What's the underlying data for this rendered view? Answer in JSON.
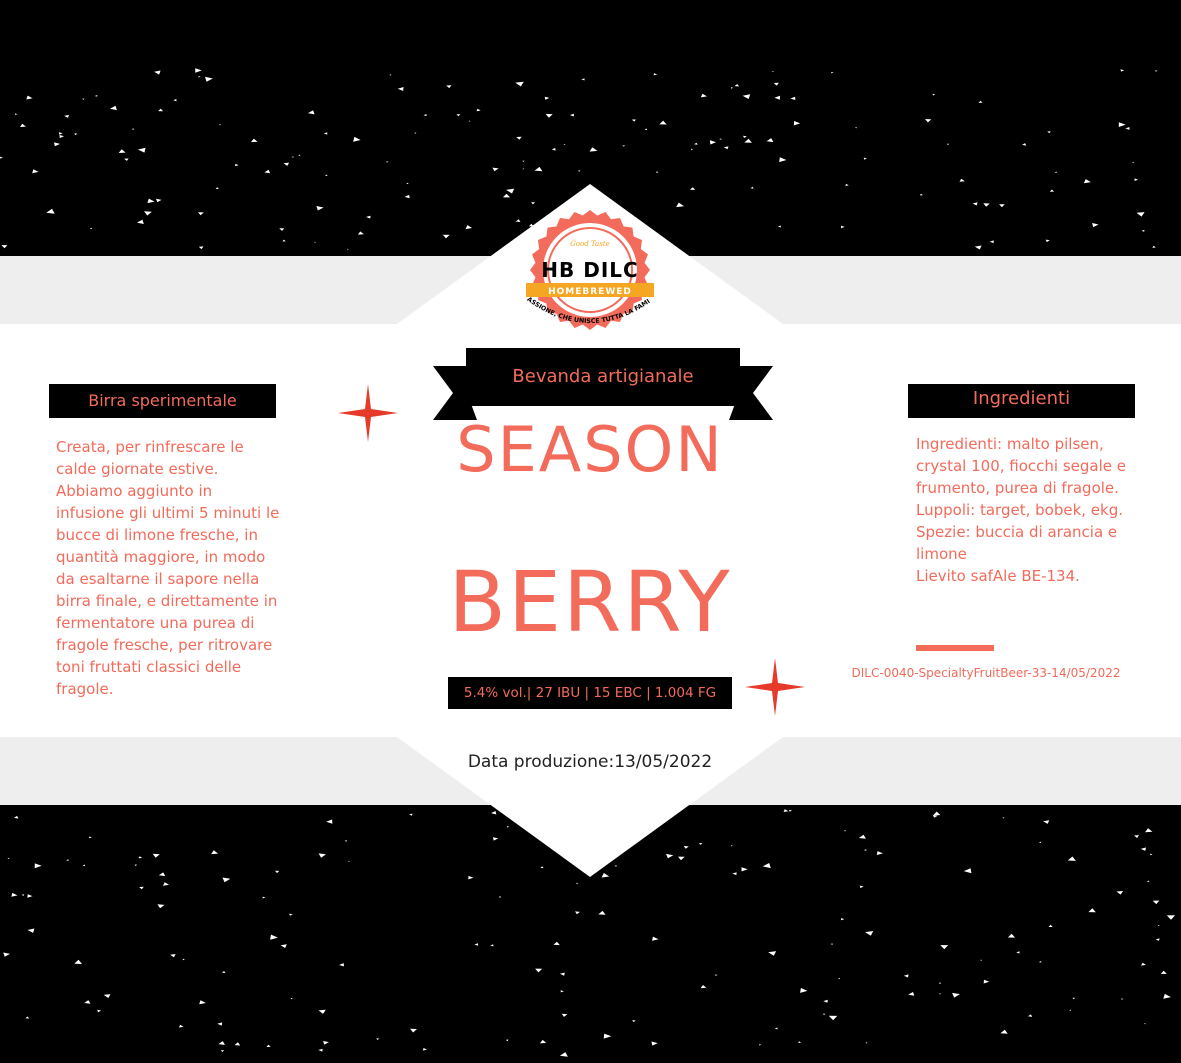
{
  "logo": {
    "brand": "HB DILC",
    "ribbon": "HOMEBREWED",
    "tagline": "Good Taste",
    "motto": "UNA PASSIONE, CHE UNISCE TUTTA LA FAMIGLIA!!!"
  },
  "banner": {
    "label": "Bevanda artigianale"
  },
  "title": {
    "line1": "SEASON",
    "line2": "BERRY"
  },
  "stats": {
    "text": "5.4% vol.| 27 IBU | 15 EBC | 1.004 FG"
  },
  "production": {
    "text": "Data produzione:13/05/2022"
  },
  "left_panel": {
    "title": "Birra sperimentale",
    "body": "Creata, per rinfrescare le\ncalde giornate estive.\nAbbiamo aggiunto in\ninfusione gli ultimi 5 minuti le\nbucce di limone fresche, in\nquantità maggiore, in modo\nda esaltarne il sapore nella\nbirra finale, e direttamente in\nfermentatore una purea di\nfragole fresche, per ritrovare\ntoni fruttati classici delle\nfragole."
  },
  "right_panel": {
    "title": "Ingredienti",
    "body": "Ingredienti: malto pilsen,\ncrystal 100, fiocchi segale e\nfrumento, purea di fragole.\nLuppoli: target, bobek, ekg.\nSpezie: buccia di arancia e\nlimone\nLievito safAle BE-134.",
    "code": "DILC-0040-SpecialtyFruitBeer-33-14/05/2022"
  },
  "colors": {
    "accent": "#f26b5b",
    "ribbon": "#f5a623",
    "band": "#eeeeee",
    "background": "#000000",
    "white": "#ffffff"
  },
  "icons": [
    "sparkle-icon",
    "sparkle-icon"
  ]
}
